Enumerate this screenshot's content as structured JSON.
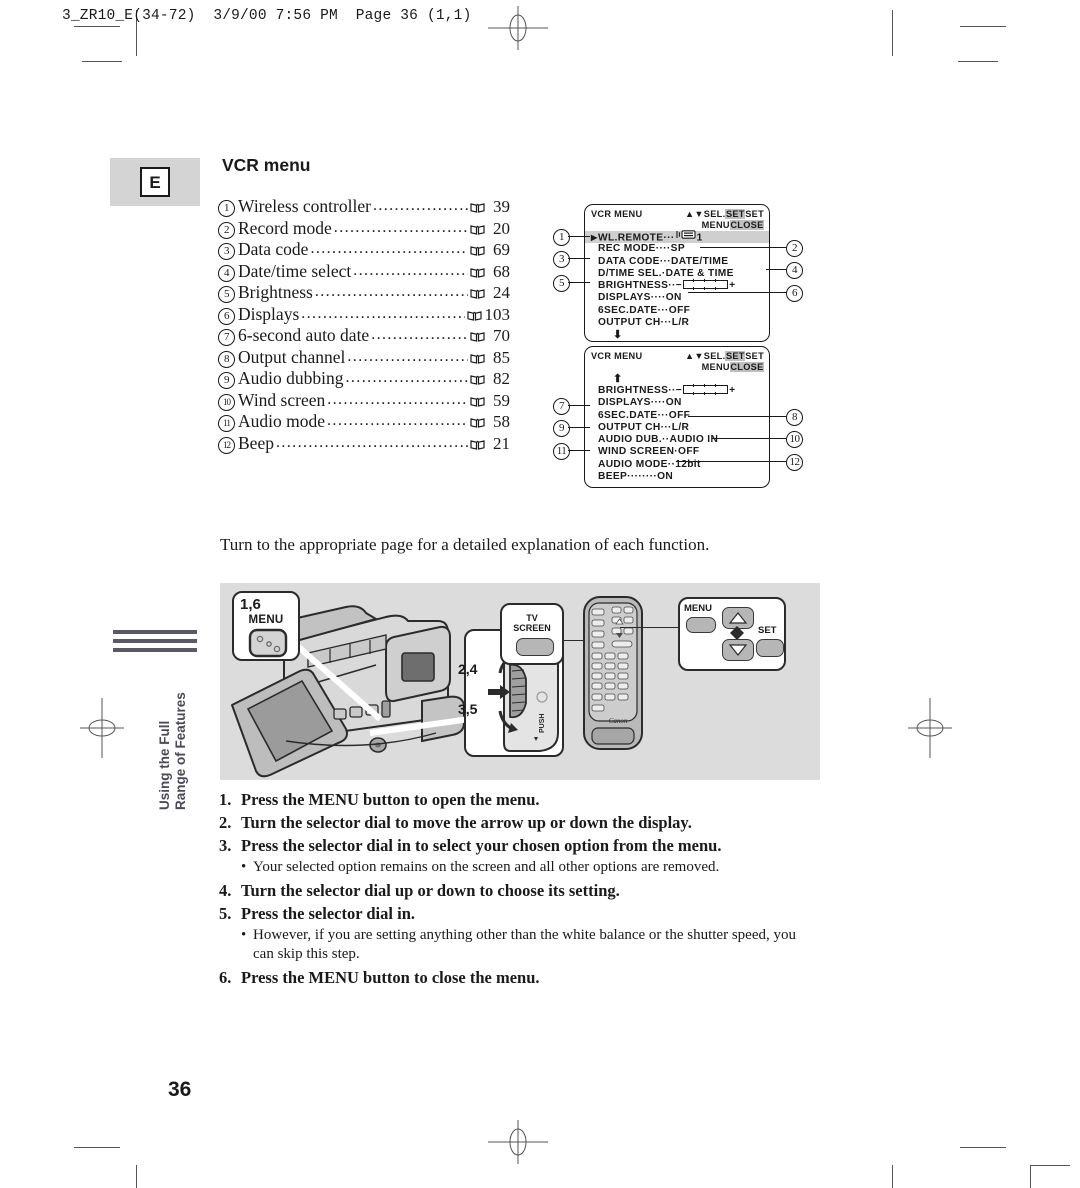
{
  "print_slug": "3_ZR10_E(34-72)  3/9/00 7:56 PM  Page 36 (1,1)",
  "language_badge": "E",
  "section_title": "VCR menu",
  "folio": "36",
  "side_tab": "Using the Full\nRange of Features",
  "intro_text": "Turn to the appropriate page for a detailed explanation of each function.",
  "toc": {
    "items": [
      {
        "num": "1",
        "label": "Wireless controller",
        "page": "39"
      },
      {
        "num": "2",
        "label": "Record mode",
        "page": "20"
      },
      {
        "num": "3",
        "label": "Data code",
        "page": "69"
      },
      {
        "num": "4",
        "label": "Date/time select",
        "page": "68"
      },
      {
        "num": "5",
        "label": "Brightness",
        "page": "24"
      },
      {
        "num": "6",
        "label": "Displays",
        "page": "103"
      },
      {
        "num": "7",
        "label": "6-second auto date",
        "page": "70"
      },
      {
        "num": "8",
        "label": "Output channel",
        "page": "85"
      },
      {
        "num": "9",
        "label": "Audio dubbing",
        "page": "82"
      },
      {
        "num": "10",
        "label": "Wind screen",
        "page": "59"
      },
      {
        "num": "11",
        "label": "Audio mode",
        "page": "58"
      },
      {
        "num": "12",
        "label": "Beep",
        "page": "21"
      }
    ]
  },
  "lcd_panels": [
    {
      "title": "VCR MENU",
      "head_line1_plain": "▲▼SEL.",
      "head_line1_inv": "SET",
      "head_line1_tail": "SET",
      "head_line2_plain": "MENU",
      "head_line2_inv": "CLOSE",
      "rows": [
        {
          "arrow": "▶",
          "text": "WL.REMOTE···",
          "value": "1",
          "icon": "wl-remote-icon",
          "highlight": true
        },
        {
          "arrow": "",
          "text": "REC MODE····SP"
        },
        {
          "arrow": "",
          "text": "DATA CODE···DATE/TIME"
        },
        {
          "arrow": "",
          "text": "D/TIME SEL.·DATE & TIME"
        },
        {
          "arrow": "",
          "text": "BRIGHTNESS··",
          "slider": true
        },
        {
          "arrow": "",
          "text": "DISPLAYS····ON"
        },
        {
          "arrow": "",
          "text": "6SEC.DATE···OFF"
        },
        {
          "arrow": "",
          "text": "OUTPUT CH···L/R"
        }
      ],
      "scroll_arrow": "⬇"
    },
    {
      "title": "VCR MENU",
      "head_line1_plain": "▲▼SEL.",
      "head_line1_inv": "SET",
      "head_line1_tail": "SET",
      "head_line2_plain": "MENU",
      "head_line2_inv": "CLOSE",
      "scroll_arrow": "⬆",
      "rows": [
        {
          "arrow": "",
          "text": "BRIGHTNESS··",
          "slider": true
        },
        {
          "arrow": "",
          "text": "DISPLAYS····ON"
        },
        {
          "arrow": "",
          "text": "6SEC.DATE···OFF"
        },
        {
          "arrow": "",
          "text": "OUTPUT CH···L/R"
        },
        {
          "arrow": "",
          "text": "AUDIO DUB.··AUDIO IN"
        },
        {
          "arrow": "",
          "text": "WIND SCREEN·OFF"
        },
        {
          "arrow": "",
          "text": "AUDIO MODE··12bit"
        },
        {
          "arrow": "",
          "text": "BEEP········ON"
        }
      ]
    }
  ],
  "callouts": [
    "1",
    "2",
    "3",
    "4",
    "5",
    "6",
    "7",
    "8",
    "9",
    "10",
    "11",
    "12"
  ],
  "illustration": {
    "menu_callout_steps": "1,6",
    "menu_button_label": "MENU",
    "dial_up_steps": "2,4",
    "dial_in_steps": "3,5",
    "dial_push_label": "PUSH",
    "remote_brand": "Canon",
    "remote_tv_screen_label": "TV\nSCREEN",
    "remote_menu_label": "MENU",
    "remote_set_label": "SET"
  },
  "steps": [
    {
      "n": "1.",
      "text": "Press the MENU button to open the menu.",
      "bullets": []
    },
    {
      "n": "2.",
      "text": "Turn the selector dial to move the arrow up or down the display.",
      "bullets": []
    },
    {
      "n": "3.",
      "text": "Press the selector dial in to select your chosen option from the menu.",
      "bullets": [
        "Your selected option remains on the screen and all other options are removed."
      ]
    },
    {
      "n": "4.",
      "text": "Turn the selector dial up or down to choose its setting.",
      "bullets": []
    },
    {
      "n": "5.",
      "text": "Press the selector dial in.",
      "bullets": [
        "However, if you are setting anything other than the white balance or the shutter speed, you can skip this step."
      ]
    },
    {
      "n": "6.",
      "text": "Press the MENU button to close the menu.",
      "bullets": []
    }
  ],
  "colors": {
    "ink": "#1a1a1a",
    "illustration_bg": "#dcdcdc",
    "lang_box_bg": "#d4d4d4",
    "lcd_highlight": "#cfcfcf",
    "tab_gray": "#5a5a66"
  }
}
